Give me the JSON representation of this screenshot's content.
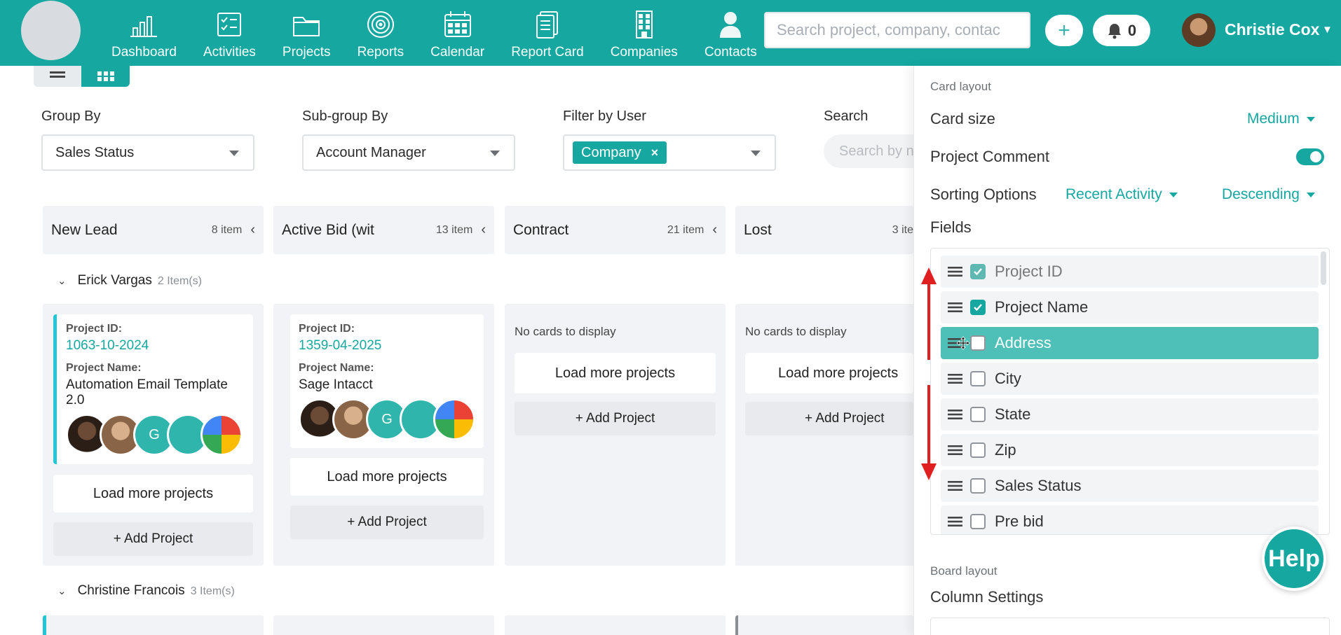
{
  "nav": {
    "items": [
      {
        "label": "Dashboard",
        "icon": "chart-bars-icon"
      },
      {
        "label": "Activities",
        "icon": "checklist-icon"
      },
      {
        "label": "Projects",
        "icon": "folder-icon"
      },
      {
        "label": "Reports",
        "icon": "target-icon"
      },
      {
        "label": "Calendar",
        "icon": "calendar-icon"
      },
      {
        "label": "Report Card",
        "icon": "document-icon"
      },
      {
        "label": "Companies",
        "icon": "building-icon"
      },
      {
        "label": "Contacts",
        "icon": "person-icon"
      }
    ],
    "search_placeholder": "Search project, company, contac",
    "notifications_count": "0",
    "user_name": "Christie Cox",
    "brand_color": "#15a7a0"
  },
  "filters": {
    "group_by_label": "Group By",
    "group_by_value": "Sales Status",
    "subgroup_label": "Sub-group By",
    "subgroup_value": "Account Manager",
    "filter_user_label": "Filter by User",
    "filter_user_chip": "Company",
    "search_label": "Search",
    "search_placeholder": "Search by n"
  },
  "board": {
    "columns": [
      {
        "title": "New Lead",
        "count": "8 item"
      },
      {
        "title": "Active Bid (wit",
        "count": "13 item"
      },
      {
        "title": "Contract",
        "count": "21 item"
      },
      {
        "title": "Lost",
        "count": "3 ite"
      }
    ],
    "groups": [
      {
        "name": "Erick Vargas",
        "count": "2 Item(s)"
      },
      {
        "name": "Christine Francois",
        "count": "3 Item(s)"
      }
    ],
    "cards": [
      {
        "id_label": "Project ID:",
        "id": "1063-10-2024",
        "name_label": "Project Name:",
        "name": "Automation Email Template 2.0",
        "avatar_initial": "G"
      },
      {
        "id_label": "Project ID:",
        "id": "1359-04-2025",
        "name_label": "Project Name:",
        "name": "Sage Intacct",
        "avatar_initial": "G"
      }
    ],
    "no_cards_text": "No cards to display",
    "load_more_label": "Load more projects",
    "add_project_label": "+ Add Project"
  },
  "panel": {
    "card_layout_label": "Card layout",
    "card_size_label": "Card size",
    "card_size_value": "Medium",
    "project_comment_label": "Project Comment",
    "project_comment_on": true,
    "sorting_label": "Sorting Options",
    "sort_field": "Recent Activity",
    "sort_order": "Descending",
    "fields_label": "Fields",
    "fields": [
      {
        "name": "Project ID",
        "checked": true
      },
      {
        "name": "Project Name",
        "checked": true
      },
      {
        "name": "Address",
        "checked": false
      },
      {
        "name": "City",
        "checked": false
      },
      {
        "name": "State",
        "checked": false
      },
      {
        "name": "Zip",
        "checked": false
      },
      {
        "name": "Sales Status",
        "checked": false
      },
      {
        "name": "Pre bid",
        "checked": false
      }
    ],
    "board_layout_label": "Board layout",
    "column_settings_label": "Column Settings"
  },
  "help_label": "Help"
}
